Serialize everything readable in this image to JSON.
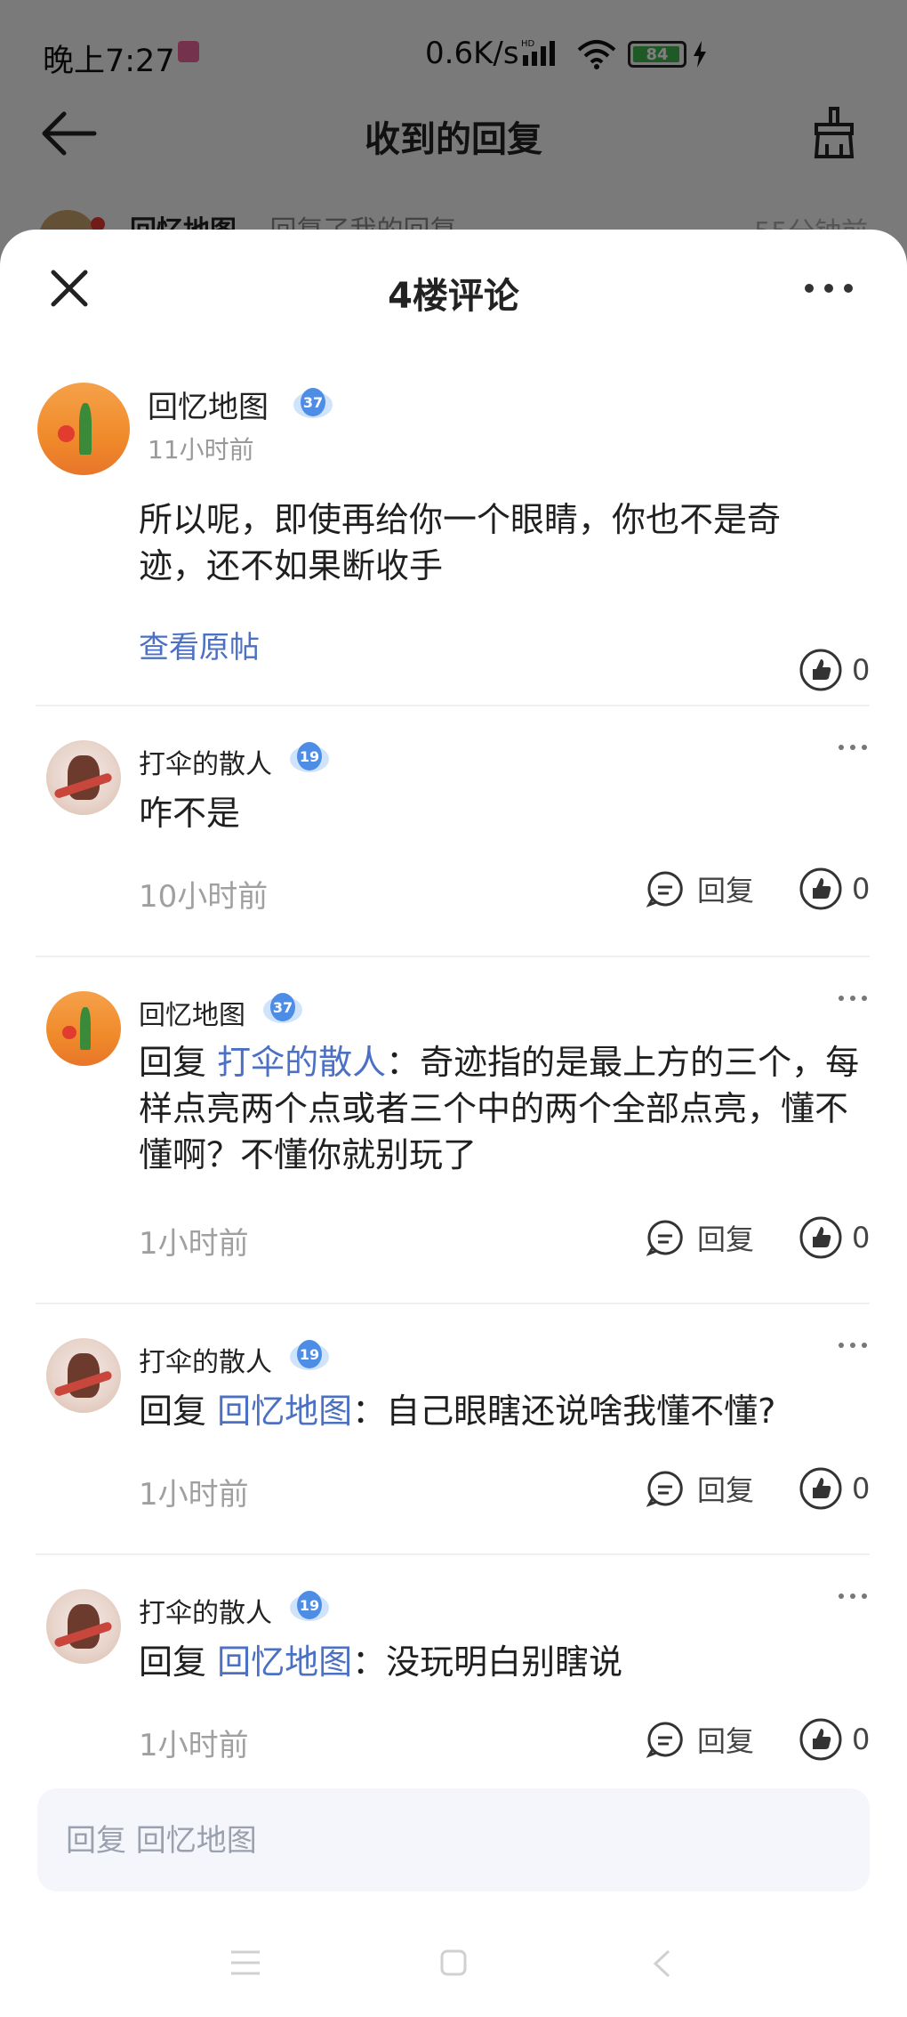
{
  "status_bar": {
    "time": "晚上7:27",
    "network_speed": "0.6K/s",
    "network_type": "HD",
    "battery_level": "84",
    "battery_color": "#3fb24a"
  },
  "header": {
    "title": "收到的回复",
    "back_icon": "arrow-left-icon",
    "clear_icon": "broom-icon"
  },
  "background_item": {
    "user": "回忆地图",
    "action": "回复了我的回复",
    "time": "55分钟前"
  },
  "sheet": {
    "title": "4楼评论",
    "close_icon": "close-icon",
    "more_icon": "more-dots-icon"
  },
  "main_post": {
    "user": "回忆地图",
    "level": "37",
    "time": "11小时前",
    "content": "所以呢，即使再给你一个眼睛，你也不是奇迹，还不如果断收手",
    "view_original": "查看原帖",
    "likes": "0"
  },
  "replies": [
    {
      "user": "打伞的散人",
      "level": "19",
      "prefix": "",
      "target": "",
      "separator": "",
      "content": "咋不是",
      "time": "10小时前",
      "reply_label": "回复",
      "likes": "0"
    },
    {
      "user": "回忆地图",
      "level": "37",
      "prefix": "回复 ",
      "target": "打伞的散人",
      "separator": "：",
      "content": "奇迹指的是最上方的三个，每样点亮两个点或者三个中的两个全部点亮，懂不懂啊？不懂你就别玩了",
      "time": "1小时前",
      "reply_label": "回复",
      "likes": "0"
    },
    {
      "user": "打伞的散人",
      "level": "19",
      "prefix": "回复 ",
      "target": "回忆地图",
      "separator": "：",
      "content": "自己眼瞎还说啥我懂不懂?",
      "time": "1小时前",
      "reply_label": "回复",
      "likes": "0"
    },
    {
      "user": "打伞的散人",
      "level": "19",
      "prefix": "回复 ",
      "target": "回忆地图",
      "separator": "：",
      "content": "没玩明白别瞎说",
      "time": "1小时前",
      "reply_label": "回复",
      "likes": "0"
    }
  ],
  "input": {
    "placeholder": "回复 回忆地图"
  },
  "nav": {
    "menu_icon": "menu-icon",
    "home_icon": "home-icon",
    "back_icon": "back-triangle-icon"
  },
  "colors": {
    "link": "#4b70c4",
    "level_badge": "#4e8de6"
  }
}
